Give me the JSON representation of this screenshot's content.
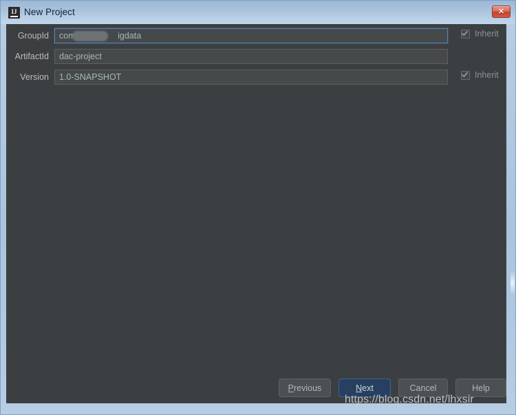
{
  "window": {
    "title": "New Project",
    "app_icon": "intellij-idea-icon",
    "icon_letters": "IJ",
    "close_label": "✕"
  },
  "form": {
    "fields": [
      {
        "label": "GroupId",
        "value": "com.",
        "value_suffix": "igdata",
        "redacted": true,
        "focused": true,
        "inherit_label": "Inherit",
        "inherit_checked": true
      },
      {
        "label": "ArtifactId",
        "value": "dac-project",
        "redacted": false,
        "focused": false
      },
      {
        "label": "Version",
        "value": "1.0-SNAPSHOT",
        "redacted": false,
        "focused": false,
        "inherit_label": "Inherit",
        "inherit_checked": true
      }
    ]
  },
  "buttons": {
    "previous": {
      "mnemonic": "P",
      "rest": "revious"
    },
    "next": {
      "mnemonic": "N",
      "rest": "ext"
    },
    "cancel": {
      "label": "Cancel"
    },
    "help": {
      "label": "Help"
    }
  },
  "watermark": {
    "text": "https://blog.csdn.net/lhxsir"
  },
  "colors": {
    "panel_bg": "#3c3f41",
    "field_bg": "#45494a",
    "focus_border": "#5781b5",
    "default_button_bg": "#27405f",
    "titlebar_top": "#9cb8d6",
    "titlebar_bottom": "#c2d6ea",
    "close_button": "#c4412e"
  }
}
